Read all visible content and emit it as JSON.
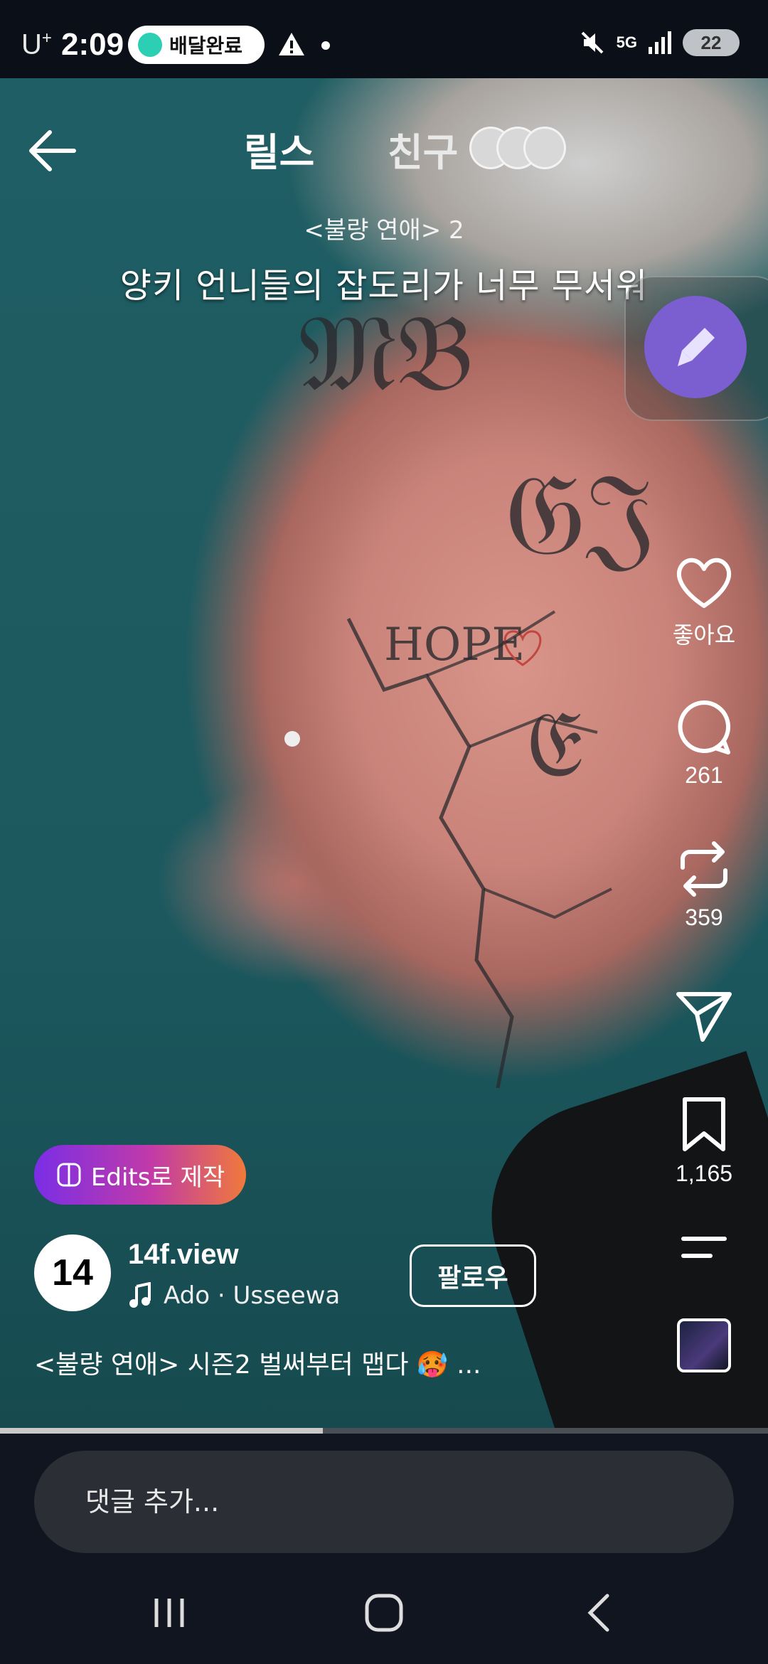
{
  "status_bar": {
    "carrier": "U",
    "carrier_sup": "+",
    "time": "2:09",
    "notification_pill": "배달완료",
    "network": "5G",
    "battery": "22"
  },
  "top_nav": {
    "tab_reels": "릴스",
    "tab_friends": "친구"
  },
  "video_overlay": {
    "title": "<불량 연애> 2",
    "subtitle": "양키 언니들의 잡도리가 너무 무서워"
  },
  "actions": {
    "like_label": "좋아요",
    "comment_count": "261",
    "repost_count": "359",
    "save_count": "1,165"
  },
  "edits_chip": {
    "label": "Edits로 제작"
  },
  "author": {
    "avatar_text": "14",
    "username": "14f.view",
    "music": "Ado · Usseewa",
    "follow_label": "팔로우"
  },
  "caption": "<불량 연애> 시즌2 벌써부터 맵다 🥵 ...",
  "playback": {
    "progress": 0.42
  },
  "comment": {
    "placeholder": "댓글 추가..."
  },
  "icons": {
    "back": "arrow-left-icon",
    "like": "heart-icon",
    "comment": "comment-bubble-icon",
    "repost": "repost-icon",
    "share": "send-icon",
    "save": "bookmark-icon",
    "more": "menu-lines-icon",
    "edit": "brush-icon",
    "music": "music-note-icon"
  },
  "colors": {
    "edit_button": "#7b5fd0",
    "chip_gradient_start": "#7a2ee6",
    "chip_gradient_end": "#f07a3a",
    "status_pill_dot": "#2ccfb4"
  }
}
